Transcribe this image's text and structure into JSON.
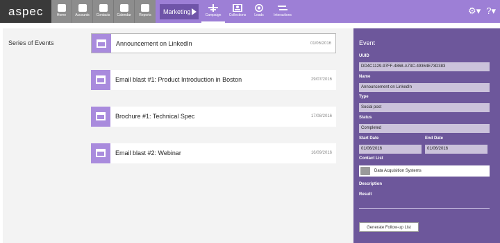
{
  "app": {
    "logo": "aspec"
  },
  "nav_gray": [
    {
      "label": "Home",
      "icon": "home-icon"
    },
    {
      "label": "Accounts",
      "icon": "building-icon"
    },
    {
      "label": "Contacts",
      "icon": "people-icon"
    },
    {
      "label": "Calendar",
      "icon": "calendar-icon"
    },
    {
      "label": "Reports",
      "icon": "bar-chart-icon"
    }
  ],
  "nav_purple": {
    "marketing": "Marketing",
    "campaign": "Campaign",
    "collections": "Collections",
    "leads": "Leads",
    "interactions": "Interactions"
  },
  "main": {
    "series_label": "Series of Events",
    "events": [
      {
        "title": "Announcement on LinkedIn",
        "date": "01/06/2016"
      },
      {
        "title": "Email blast #1: Product Introduction in Boston",
        "date": "29/07/2016"
      },
      {
        "title": "Brochure #1: Technical Spec",
        "date": "17/08/2016"
      },
      {
        "title": "Email blast #2: Webinar",
        "date": "16/09/2016"
      }
    ]
  },
  "panel": {
    "title": "Event",
    "uuid_label": "UUID",
    "uuid": "DD4C1129-97FF-4868-A73C-49364E73D383",
    "name_label": "Name",
    "name": "Announcement on LinkedIn",
    "type_label": "Type",
    "type": "Social post",
    "status_label": "Status",
    "status": "Completed",
    "start_label": "Start Date",
    "start": "01/06/2016",
    "end_label": "End Date",
    "end": "01/06/2016",
    "contact_label": "Contact List",
    "contact": "Data Acquisition Systems",
    "description_label": "Description",
    "result_label": "Result",
    "followup_button": "Generate Follow-up List"
  },
  "colors": {
    "accent": "#9d7fd6",
    "panel": "#6d579b",
    "dark": "#3a3a3a"
  }
}
